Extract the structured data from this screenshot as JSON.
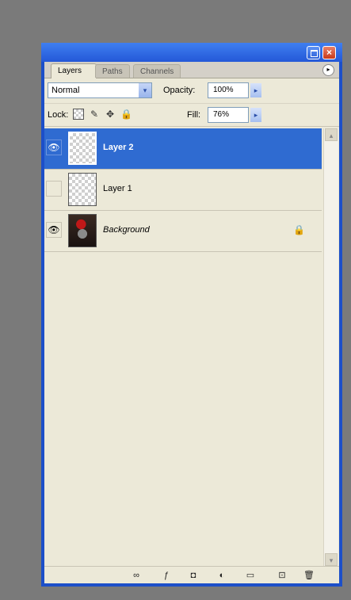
{
  "tabs": [
    "Layers",
    "Paths",
    "Channels"
  ],
  "window_controls": {
    "close": "×"
  },
  "blend_mode": "Normal",
  "opacity": {
    "label": "Opacity:",
    "value": "100%"
  },
  "lock": {
    "label": "Lock:"
  },
  "fill": {
    "label": "Fill:",
    "value": "76%"
  },
  "layers": [
    {
      "name": "Layer 2",
      "visible": true,
      "selected": true
    },
    {
      "name": "Layer 1",
      "visible": false,
      "selected": false
    },
    {
      "name": "Background",
      "visible": true,
      "selected": false,
      "locked": true
    }
  ],
  "icons": {
    "eye": "👁",
    "lock": "🔒",
    "panel_menu": "▸",
    "dropdown": "▾",
    "stepper": "▸",
    "scroll_up": "▴",
    "scroll_down": "▾",
    "link": "∞",
    "style": "ƒ",
    "mask": "◘",
    "adjustment": "◐",
    "group": "▭",
    "new": "⊡",
    "delete": "🗑"
  }
}
